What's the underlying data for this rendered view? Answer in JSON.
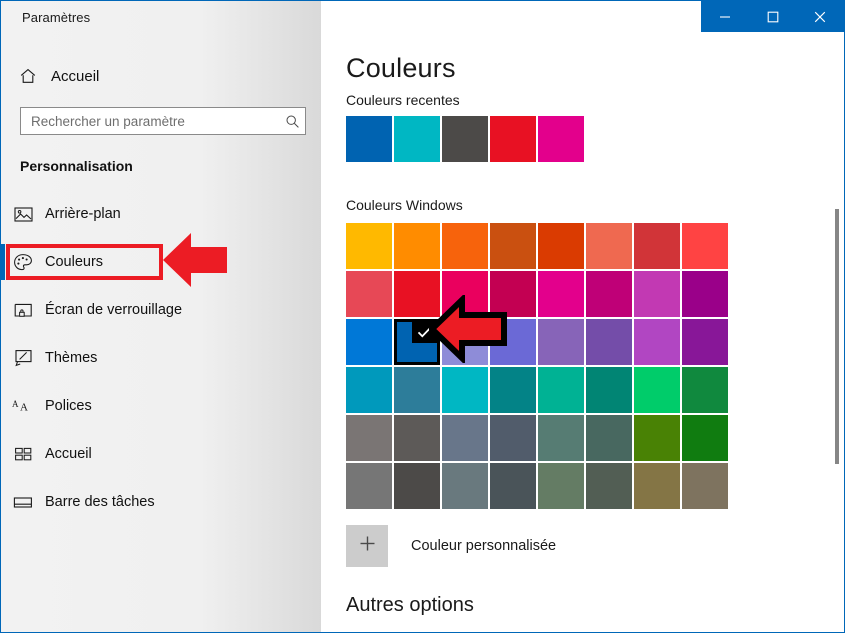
{
  "window": {
    "app_title": "Paramètres",
    "accent_color": "#0067b8",
    "controls": [
      {
        "name": "minimize",
        "glyph": "minimize-icon"
      },
      {
        "name": "maximize",
        "glyph": "maximize-icon"
      },
      {
        "name": "close",
        "glyph": "close-icon"
      }
    ]
  },
  "sidebar": {
    "home": {
      "label": "Accueil",
      "icon": "home-icon"
    },
    "search": {
      "value": "",
      "placeholder": "Rechercher un paramètre",
      "icon": "search-icon"
    },
    "section_title": "Personnalisation",
    "items": [
      {
        "label": "Arrière-plan",
        "icon": "image-icon",
        "selected": false
      },
      {
        "label": "Couleurs",
        "icon": "palette-icon",
        "selected": true
      },
      {
        "label": "Écran de verrouillage",
        "icon": "lock-screen-icon",
        "selected": false
      },
      {
        "label": "Thèmes",
        "icon": "theme-brush-icon",
        "selected": false
      },
      {
        "label": "Polices",
        "icon": "fonts-icon",
        "selected": false
      },
      {
        "label": "Accueil",
        "icon": "start-tiles-icon",
        "selected": false
      },
      {
        "label": "Barre des tâches",
        "icon": "taskbar-icon",
        "selected": false
      }
    ]
  },
  "main": {
    "page_title": "Couleurs",
    "recent_label": "Couleurs recentes",
    "recent_colors": [
      "#0063b1",
      "#00b7c3",
      "#4c4a48",
      "#e81123",
      "#e3008c"
    ],
    "windows_label": "Couleurs Windows",
    "windows_colors": [
      [
        "#ffb900",
        "#ff8c00",
        "#f7630c",
        "#ca5010",
        "#da3b01",
        "#ef6950",
        "#d13438",
        "#ff4343"
      ],
      [
        "#e74856",
        "#e81123",
        "#ea005e",
        "#c30052",
        "#e3008c",
        "#bf0077",
        "#c239b3",
        "#9a0089"
      ],
      [
        "#0078d7",
        "#0063b1",
        "#8e8cd8",
        "#6b69d6",
        "#8764b8",
        "#744da9",
        "#b146c2",
        "#881798"
      ],
      [
        "#0099bc",
        "#2d7d9a",
        "#00b7c3",
        "#038387",
        "#00b294",
        "#018574",
        "#00cc6a",
        "#10893e"
      ],
      [
        "#7a7574",
        "#5d5a58",
        "#68768a",
        "#515c6b",
        "#567c73",
        "#486860",
        "#498205",
        "#107c10"
      ],
      [
        "#767676",
        "#4c4a48",
        "#69797e",
        "#4a5459",
        "#647c64",
        "#525e54",
        "#847545",
        "#7e735f"
      ]
    ],
    "selected_color": "#0063b1",
    "selected_row": 2,
    "selected_col": 1,
    "check_glyph": "check-icon",
    "custom_color_label": "Couleur personnalisée",
    "custom_color_icon": "plus-icon",
    "other_options_title": "Autres options"
  },
  "annotations": {
    "highlight_color": "#ec1c24",
    "sidebar_arrow": "arrow-left-pointing-to-couleurs",
    "grid_arrow": "arrow-left-pointing-to-selected-swatch"
  }
}
